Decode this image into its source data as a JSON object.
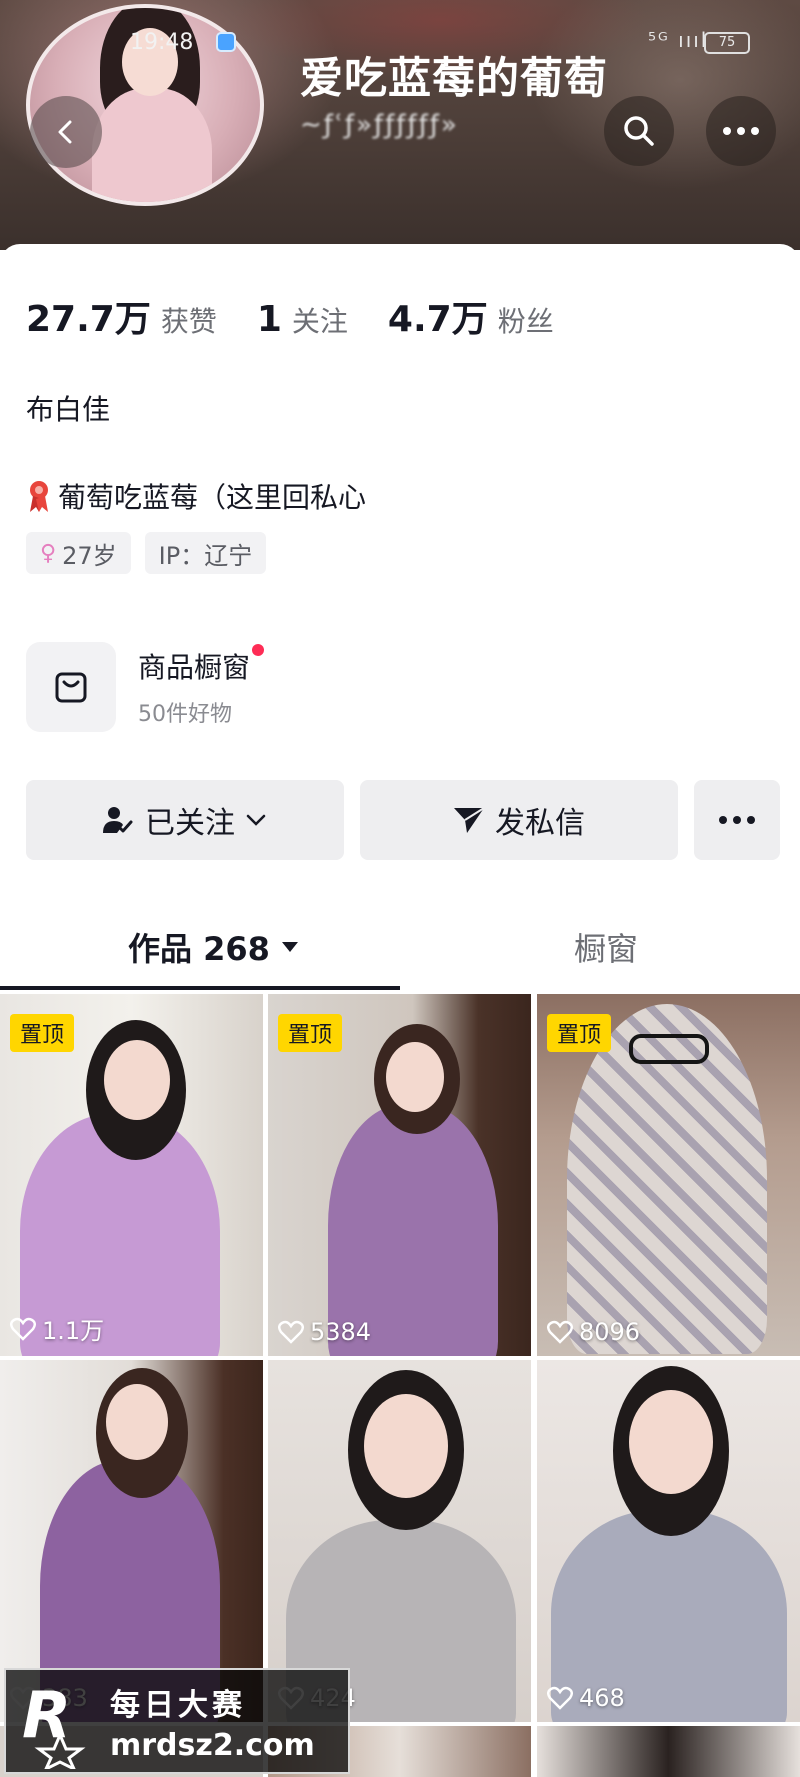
{
  "status_bar": {
    "time": "19:48",
    "signal": "⁵ᴳ ıııl",
    "battery": "75"
  },
  "header": {
    "nickname": "爱吃蓝莓的葡萄",
    "user_id": "∼ƒʿƒ»ƒƒƒƒƒƒ»"
  },
  "stats": [
    {
      "value": "27.7万",
      "label": "获赞"
    },
    {
      "value": "1",
      "label": "关注"
    },
    {
      "value": "4.7万",
      "label": "粉丝"
    }
  ],
  "bio": "布白佳",
  "pinned_line": "葡萄吃蓝莓（这里回私心",
  "tags": [
    {
      "icon": "female-icon",
      "text": "27岁"
    },
    {
      "icon": "",
      "text": "IP：辽宁"
    }
  ],
  "shop": {
    "title": "商品橱窗",
    "subtitle": "50件好物"
  },
  "actions": {
    "follow": "已关注",
    "message": "发私信"
  },
  "tabs": {
    "works": "作品 268",
    "showcase": "橱窗"
  },
  "grid": [
    {
      "pinned": "置顶",
      "likes": "1.1万"
    },
    {
      "pinned": "置顶",
      "likes": "5384"
    },
    {
      "pinned": "置顶",
      "likes": "8096"
    },
    {
      "pinned": "",
      "likes": "383"
    },
    {
      "pinned": "",
      "likes": "424"
    },
    {
      "pinned": "",
      "likes": "468"
    }
  ],
  "watermark": {
    "title": "每日大赛",
    "url": "mrdsz2.com"
  },
  "colors": {
    "accent_red": "#fe2c55",
    "pin_yellow": "#ffd600",
    "header_bg": "#4f403a"
  }
}
